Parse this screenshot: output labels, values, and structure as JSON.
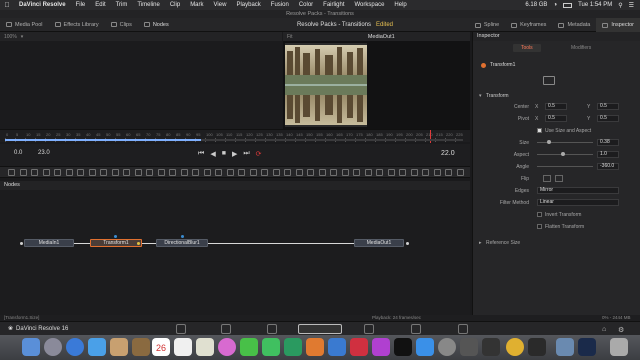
{
  "menubar": {
    "app": "DaVinci Resolve",
    "items": [
      "File",
      "Edit",
      "Trim",
      "Timeline",
      "Clip",
      "Mark",
      "View",
      "Playback",
      "Fusion",
      "Color",
      "Fairlight",
      "Workspace",
      "Help"
    ],
    "battery": "6.18 GB",
    "clock": "Tue 1:54 PM"
  },
  "window_title": "Resolve Packs - Transitions",
  "toolbar": {
    "media_pool": "Media Pool",
    "effects_library": "Effects Library",
    "clips": "Clips",
    "nodes": "Nodes",
    "project_title": "Resolve Packs - Transitions",
    "edited": "Edited",
    "spline": "Spline",
    "keyframes": "Keyframes",
    "metadata": "Metadata",
    "inspector": "Inspector"
  },
  "viewer": {
    "left_zoom": "100%",
    "right_zoom": "Fit",
    "right_title": "MediaOut1"
  },
  "ruler": {
    "ticks": [
      "0",
      "5",
      "10",
      "15",
      "20",
      "25",
      "30",
      "35",
      "40",
      "45",
      "50",
      "55",
      "60",
      "65",
      "70",
      "75",
      "80",
      "85",
      "90",
      "95",
      "100",
      "105",
      "110",
      "115",
      "120",
      "125",
      "130",
      "135",
      "140",
      "145",
      "150",
      "155",
      "160",
      "165",
      "170",
      "175",
      "180",
      "185",
      "190",
      "195",
      "200",
      "205",
      "210",
      "215",
      "220",
      "225",
      "230"
    ]
  },
  "transport": {
    "start": "0.0",
    "end": "23.0",
    "current": "22.0"
  },
  "nodes_panel": {
    "title": "Nodes",
    "nodes": [
      "MediaIn1",
      "Transform1",
      "DirectionalBlur1",
      "MediaOut1"
    ]
  },
  "inspector": {
    "title": "Inspector",
    "tab_tools": "Tools",
    "tab_modifiers": "Modifiers",
    "node_name": "Transform1",
    "section": "Transform",
    "center_label": "Center",
    "center_x": "0.5",
    "center_y": "0.5",
    "pivot_label": "Pivot",
    "pivot_x": "0.5",
    "pivot_y": "0.5",
    "use_size_aspect": "Use Size and Aspect",
    "size_label": "Size",
    "size_val": "0.38",
    "aspect_label": "Aspect",
    "aspect_val": "1.0",
    "angle_label": "Angle",
    "angle_val": "-360.0",
    "flip_label": "Flip",
    "edges_label": "Edges",
    "edges_val": "Mirror",
    "filter_label": "Filter Method",
    "filter_val": "Linear",
    "invert_label": "Invert Transform",
    "flatten_label": "Flatten Transform",
    "reference_size": "Reference Size"
  },
  "status": {
    "left": "[Transform1.Size]",
    "middle": "Playback: 24 frames/sec",
    "right": "0% - 2444 MB"
  },
  "pagebar": {
    "app_name": "DaVinci Resolve 16"
  },
  "colors": {
    "accent": "#ff7a5a",
    "edited": "#e7c052",
    "selected_node": "#e07030"
  },
  "dock": {
    "calendar_day": "26"
  }
}
